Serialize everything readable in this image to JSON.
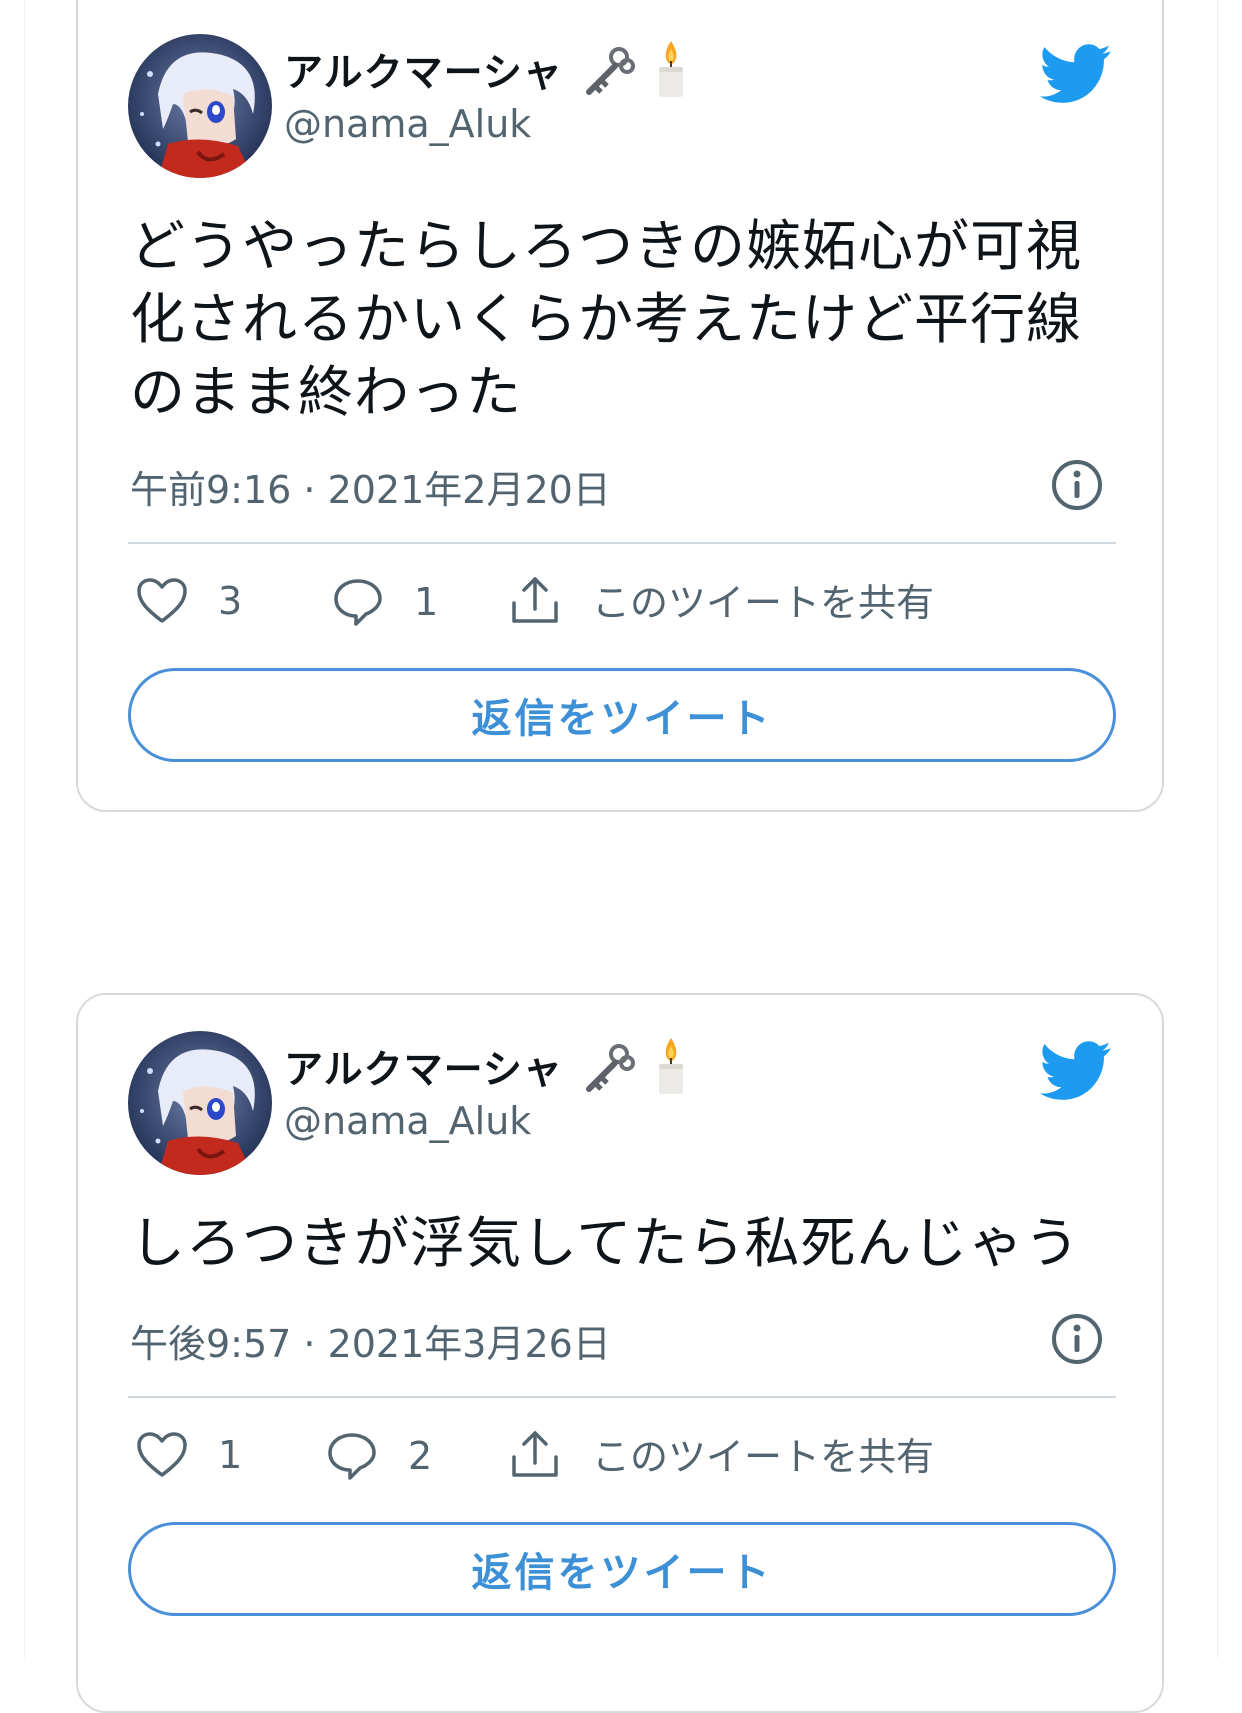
{
  "colors": {
    "accent": "#4a90d9",
    "twitter_blue": "#1d9bf0",
    "secondary_text": "#536471",
    "border": "#d6dadd"
  },
  "tweets": [
    {
      "display_name": "アルクマーシャ",
      "name_emojis": [
        "old-key-icon",
        "candle-icon"
      ],
      "handle": "@nama_Aluk",
      "text_lines": [
        "どうやったらしろつきの嫉妬心が可視",
        "化されるかいくらか考えたけど平行線",
        "のまま終わった"
      ],
      "timestamp": "午前9:16 · 2021年2月20日",
      "likes": "3",
      "replies": "1",
      "share_label": "このツイートを共有",
      "reply_button_label": "返信をツイート"
    },
    {
      "display_name": "アルクマーシャ",
      "name_emojis": [
        "old-key-icon",
        "candle-icon"
      ],
      "handle": "@nama_Aluk",
      "text_lines": [
        "しろつきが浮気してたら私死んじゃう"
      ],
      "timestamp": "午後9:57 · 2021年3月26日",
      "likes": "1",
      "replies": "2",
      "share_label": "このツイートを共有",
      "reply_button_label": "返信をツイート"
    }
  ]
}
